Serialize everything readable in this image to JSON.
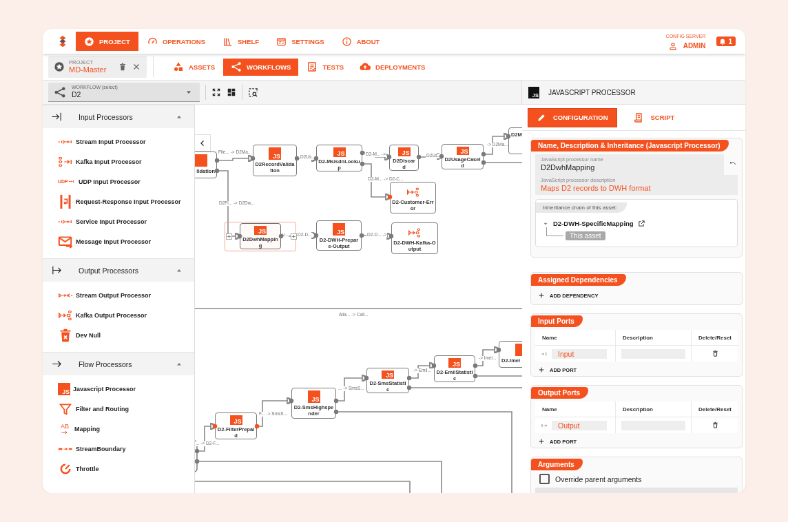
{
  "nav": {
    "items": [
      {
        "kind": "project",
        "label": "PROJECT",
        "selected": true
      },
      {
        "kind": "operations",
        "label": "OPERATIONS",
        "selected": false
      },
      {
        "kind": "shelf",
        "label": "SHELF",
        "selected": false
      },
      {
        "kind": "settings",
        "label": "SETTINGS",
        "selected": false
      },
      {
        "kind": "about",
        "label": "ABOUT",
        "selected": false
      }
    ],
    "config_label": "CONFIG SERVER",
    "user": "ADMIN",
    "notifications": "1"
  },
  "project": {
    "caption": "PROJECT",
    "name": "MD-Master"
  },
  "tabs": [
    {
      "kind": "assets",
      "label": "ASSETS",
      "selected": false
    },
    {
      "kind": "workflows",
      "label": "WORKFLOWS",
      "selected": true
    },
    {
      "kind": "tests",
      "label": "TESTS",
      "selected": false
    },
    {
      "kind": "deployments",
      "label": "DEPLOYMENTS",
      "selected": false
    }
  ],
  "workflow_select": {
    "label": "WORKFLOW (select)",
    "value": "D2"
  },
  "palette": [
    {
      "kind": "input",
      "title": "Input Processors",
      "expanded": true,
      "items": [
        {
          "kind": "stream-in",
          "label": "Stream Input Processor"
        },
        {
          "kind": "kafka-in",
          "label": "Kafka Input Processor"
        },
        {
          "kind": "udp-in",
          "label": "UDP Input Processor",
          "badge": "UDP"
        },
        {
          "kind": "request-response",
          "label": "Request-Response Input Processor"
        },
        {
          "kind": "stream-in",
          "label": "Service Input Processor"
        },
        {
          "kind": "message-in",
          "label": "Message Input Processor"
        }
      ]
    },
    {
      "kind": "output",
      "title": "Output Processors",
      "expanded": true,
      "items": [
        {
          "kind": "stream-out",
          "label": "Stream Output Processor"
        },
        {
          "kind": "kafka-out",
          "label": "Kafka Output Processor"
        },
        {
          "kind": "dev-null",
          "label": "Dev Null"
        }
      ]
    },
    {
      "kind": "flow",
      "title": "Flow Processors",
      "expanded": true,
      "items": [
        {
          "kind": "js",
          "label": "Javascript Processor",
          "badge": "JS"
        },
        {
          "kind": "filter",
          "label": "Filter and Routing"
        },
        {
          "kind": "mapping",
          "label": "Mapping",
          "badge": "AB"
        },
        {
          "kind": "stream-boundary",
          "label": "StreamBoundary"
        },
        {
          "kind": "throttle",
          "label": "Throttle"
        }
      ]
    }
  ],
  "canvas": {
    "nodes": [
      {
        "kind": "js",
        "label": "lidation",
        "selected": false,
        "output_flagged": false
      },
      {
        "kind": "js",
        "badge": "JS",
        "label": "D2RecordValidation",
        "selected": false,
        "input_flagged": false,
        "output_flagged": false
      },
      {
        "kind": "js",
        "badge": "JS",
        "label": "D2-MsisdnLookup",
        "selected": false,
        "input_flagged": false,
        "output_flagged": false
      },
      {
        "kind": "js",
        "badge": "JS",
        "label": "D2Discard",
        "selected": false,
        "input_flagged": false,
        "output_flagged": false
      },
      {
        "kind": "js",
        "badge": "JS",
        "label": "D2UsageCaseId",
        "selected": false,
        "input_flagged": false,
        "output_flagged": false
      },
      {
        "kind": "partial",
        "label": "D2M",
        "selected": false,
        "input_flagged": false
      },
      {
        "kind": "kafka-out",
        "label": "D2-Customer-Error",
        "selected": false,
        "input_flagged": true
      },
      {
        "kind": "js",
        "badge": "JS",
        "label": "D2DwhMapping",
        "selected": true,
        "input_flagged": false,
        "output_flagged": false
      },
      {
        "kind": "js",
        "badge": "JS",
        "label": "D2-DWH-Prepare-Output",
        "selected": false,
        "input_flagged": false,
        "output_flagged": false
      },
      {
        "kind": "kafka-out",
        "label": "D2-DWH-Kafka-Output",
        "selected": false,
        "input_flagged": false
      },
      {
        "kind": "js",
        "label": "D2-Imei",
        "selected": false,
        "input_flagged": false
      },
      {
        "kind": "js",
        "badge": "JS",
        "label": "D2-EmilStatistic",
        "selected": false,
        "input_flagged": false,
        "output_flagged": false
      },
      {
        "kind": "js",
        "badge": "JS",
        "label": "D2-SmsStatistic",
        "selected": false,
        "input_flagged": false,
        "output_flagged": false
      },
      {
        "kind": "js",
        "badge": "JS",
        "label": "D2-SmsHighspender",
        "selected": false,
        "input_flagged": false,
        "output_flagged": false
      },
      {
        "kind": "js",
        "badge": "JS",
        "label": "D2-FilterPrepaid",
        "selected": false,
        "input_flagged": true,
        "output_flagged": true
      }
    ],
    "edge_labels": [
      "File... -> D2Ma...",
      "D2Us...",
      "D2-M... ->",
      "D2Us...",
      "-> D2Ma...",
      "D2-M... -> D2-C...",
      "D2Fi... -> D2Dw...",
      "v...",
      "D2-D...",
      "D2-D... ->",
      "Alia... -> Call...",
      "... -> D2-F...",
      "F... -> SmsS...",
      "... -> SmsS...",
      "-> Emil...",
      "-> Imei..."
    ]
  },
  "panel": {
    "badge": "JS",
    "title": "JAVASCRIPT PROCESSOR",
    "tabs": [
      {
        "kind": "configuration",
        "label": "CONFIGURATION",
        "selected": true
      },
      {
        "kind": "script",
        "label": "SCRIPT",
        "selected": false
      }
    ],
    "identity": {
      "title": "Name, Description & Inheritance (Javascript Processor)",
      "name_label": "JavaScript processor name",
      "name": "D2DwhMapping",
      "description_label": "JavaScript processor description",
      "description": "Maps D2 records to DWH format",
      "inheritance_title": "Inheritance chain of this asset:",
      "chain": [
        {
          "label": "D2-DWH-SpecificMapping",
          "expanded": true,
          "children": [
            {
              "label": "This asset"
            }
          ]
        }
      ]
    },
    "dependencies": {
      "title": "Assigned Dependencies",
      "add": "ADD DEPENDENCY"
    },
    "port_sections": [
      {
        "kind": "input",
        "title": "Input Ports",
        "columns": [
          "Name",
          "Description",
          "Delete/Reset"
        ],
        "ports": [
          {
            "name": "Input"
          }
        ],
        "add": "ADD PORT"
      },
      {
        "kind": "output",
        "title": "Output Ports",
        "columns": [
          "Name",
          "Description",
          "Delete/Reset"
        ],
        "ports": [
          {
            "name": "Output"
          }
        ],
        "add": "ADD PORT"
      }
    ],
    "arguments": {
      "title": "Arguments",
      "override_label": "Override parent arguments",
      "override": false
    }
  }
}
